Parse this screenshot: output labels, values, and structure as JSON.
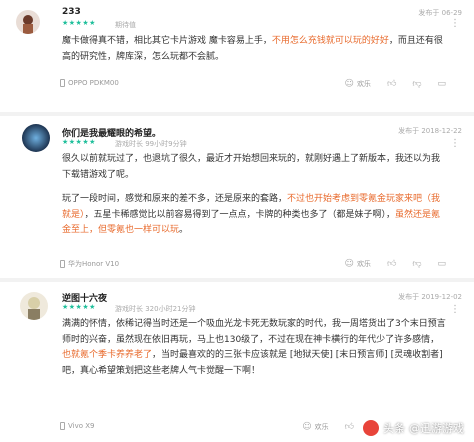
{
  "reviews": [
    {
      "username": "233",
      "stars": "★★★★★",
      "tag": "期待值",
      "date": "发布于 06-29",
      "text_1": "魔卡做得真不错，相比其它卡片游戏 魔卡容易上手，",
      "text_hl": "不用怎么充钱就可以玩的好好",
      "text_2": "，而且还有很高的研究性，牌库深，怎么玩都不会腻。",
      "device": "OPPO PDKM00",
      "actions": [
        "欢乐",
        "",
        ""
      ]
    },
    {
      "username": "你们是我最耀眼的希望。",
      "stars": "★★★★★",
      "tag": "游戏时长 99小时9分钟",
      "date": "发布于 2018-12-22",
      "p1": "很久以前就玩过了，也退坑了很久，最近才开始想回来玩的，就刚好遇上了新版本，我还以为我下载错游戏了呢。",
      "p2_a": "玩了一段时间，感觉和原来的差不多，还是原来的套路，",
      "p2_hl1": "不过也开始考虑到零氪金玩家来吧（我就是）",
      "p2_b": "，五星卡稀感觉比以前容易得到了一点点，卡牌的种类也多了（都是妹子啊），",
      "p2_hl2": "虽然还是氪金至上，但零氪也一样可以玩",
      "p2_c": "。",
      "device": "华为Honor V10",
      "actions": [
        "欢乐",
        "",
        ""
      ]
    },
    {
      "username": "逆图十六夜",
      "stars": "★★★★★",
      "tag": "游戏时长 320小时21分钟",
      "date": "发布于 2019-12-02",
      "p1_a": "满满的怀情，依稀记得当时还是一个吸血光龙卡死无数玩家的时代，我一周塔货出了3个末日预言师时的兴奋，虽然现在依旧再玩，马上也130级了，不过在现在神卡横行的年代少了许多感情，",
      "p1_hl": "也就氪个季卡养养老了",
      "p1_b": "，当时最喜欢的的三张卡应该就是 [地狱天使] [末日预言师] [灵魂收割者] 吧，真心希望策划把这些老牌人气卡觉醒一下啊！",
      "device": "Vivo X9",
      "actions": [
        "欢乐",
        "",
        ""
      ]
    }
  ],
  "watermark": {
    "prefix": "头条",
    "name": "@迅游游戏"
  },
  "colors": {
    "accent": "#1fbf9b",
    "highlight": "#e86a2c"
  },
  "icons": {
    "more": "more-icon",
    "like": "thumb-up-icon",
    "dislike": "thumb-down-icon",
    "comment": "comment-icon"
  }
}
